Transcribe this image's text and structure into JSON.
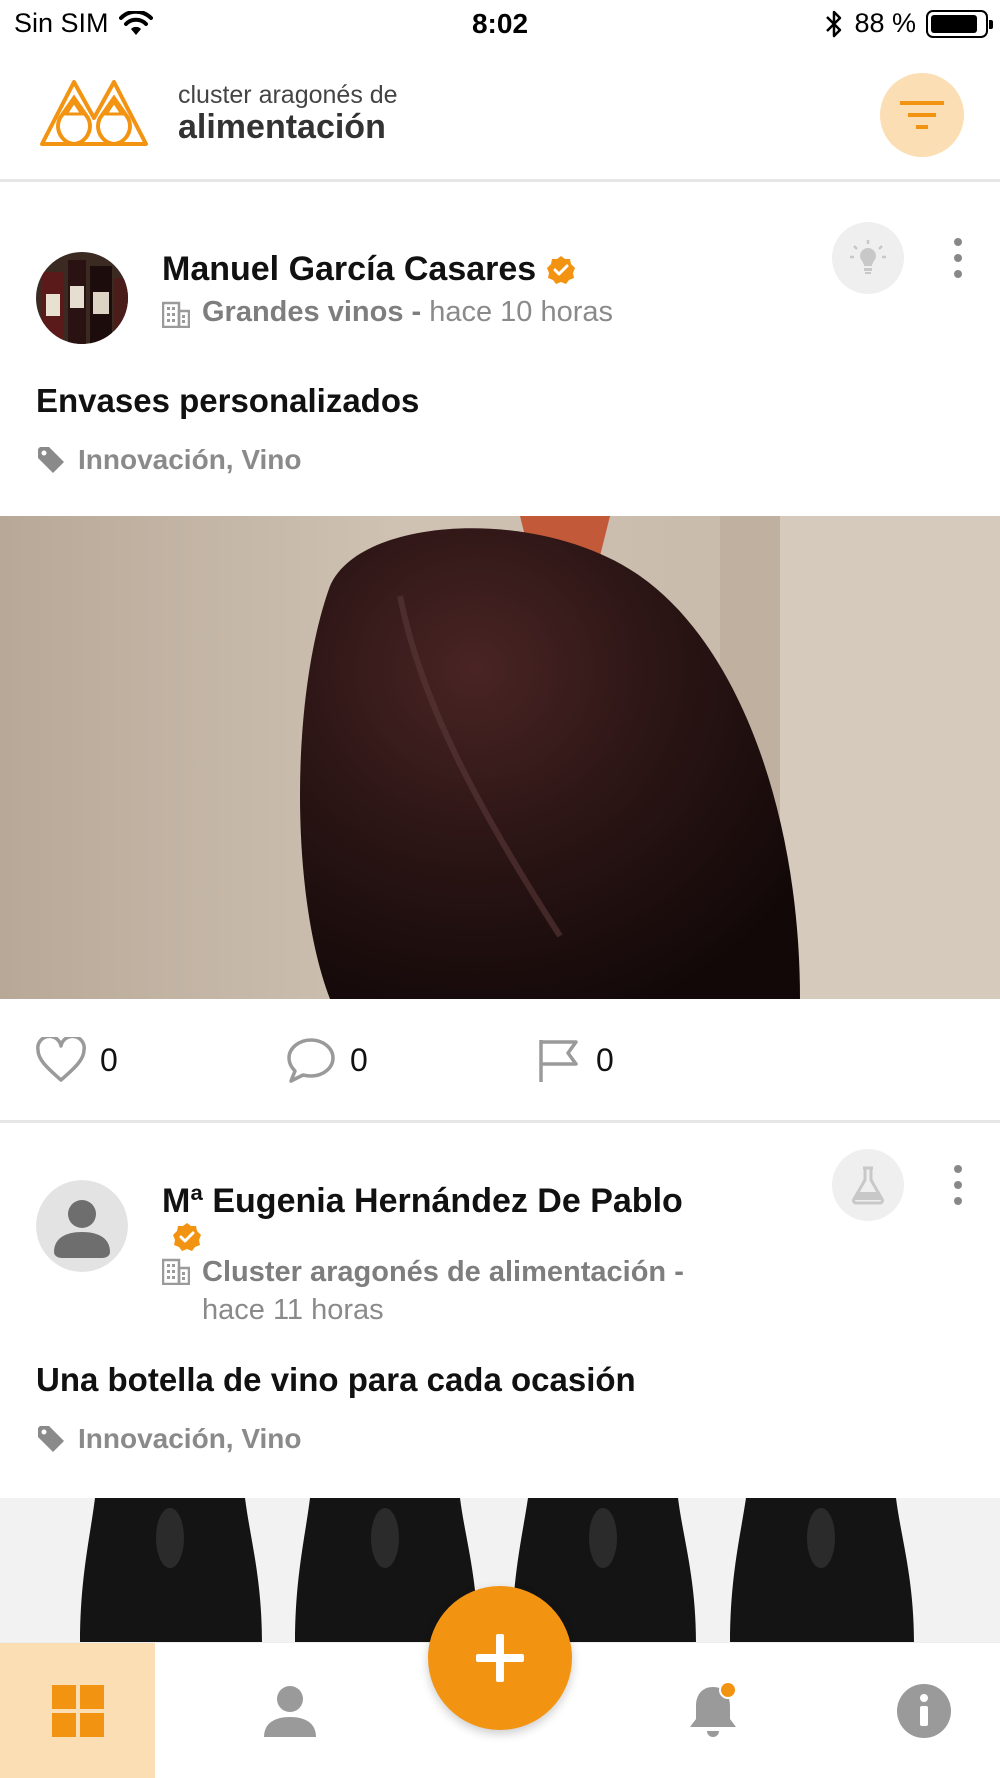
{
  "status_bar": {
    "carrier": "Sin SIM",
    "time": "8:02",
    "battery_percent": "88 %",
    "battery_level": 0.88
  },
  "header": {
    "logo_line1": "cluster aragonés de",
    "logo_line2": "alimentación",
    "filter_icon": "filter-icon"
  },
  "posts": [
    {
      "author": "Manuel García Casares",
      "verified": true,
      "company": "Grandes vinos -",
      "time": "hace 10 horas",
      "category_icon": "lightbulb-icon",
      "title": "Envases personalizados",
      "tags": "Innovación, Vino",
      "likes": "0",
      "comments": "0",
      "reports": "0"
    },
    {
      "author": "Mª Eugenia Hernández De Pablo",
      "verified": true,
      "company": "Cluster aragonés de alimentación -",
      "time": "hace 11 horas",
      "category_icon": "flask-icon",
      "title": "Una botella de vino para cada ocasión",
      "tags": "Innovación, Vino"
    }
  ],
  "bottom_nav": {
    "items": [
      "grid-icon",
      "profile-icon",
      "add-icon",
      "bell-icon",
      "info-icon"
    ],
    "active": "grid-icon"
  },
  "colors": {
    "accent": "#f39312",
    "accent_light": "#fbdeb3",
    "muted_text": "#8a8a8a",
    "icon_gray": "#9a9a9a"
  }
}
